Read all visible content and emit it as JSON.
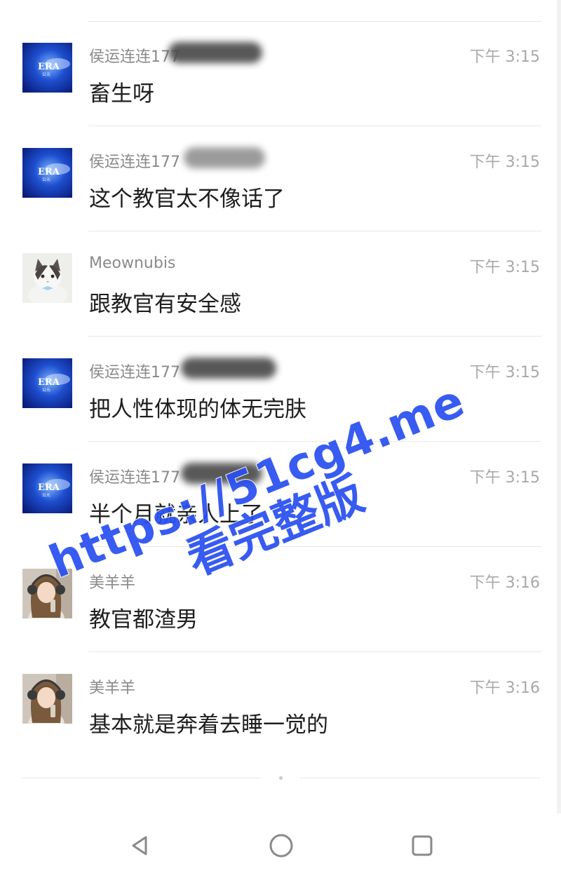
{
  "comments": [
    {
      "avatar": "era-logo",
      "username": "侯运连连177",
      "time": "下午 3:15",
      "message": "畜生呀"
    },
    {
      "avatar": "era-logo",
      "username": "侯运连连177",
      "time": "下午 3:15",
      "message": "这个教官太不像话了"
    },
    {
      "avatar": "cat-photo",
      "username": "Meownubis",
      "time": "下午 3:15",
      "message": "跟教官有安全感"
    },
    {
      "avatar": "era-logo",
      "username": "侯运连连177",
      "time": "下午 3:15",
      "message": "把人性体现的体无完肤"
    },
    {
      "avatar": "era-logo",
      "username": "侯运连连177",
      "time": "下午 3:15",
      "message": "半个月就亲人上了"
    },
    {
      "avatar": "girl-photo",
      "username": "美羊羊",
      "time": "下午 3:16",
      "message": "教官都渣男"
    },
    {
      "avatar": "girl-photo",
      "username": "美羊羊",
      "time": "下午 3:16",
      "message": "基本就是奔着去睡一觉的"
    }
  ],
  "avatar_logo_text": "ERA",
  "avatar_logo_subtext": "公元",
  "watermark": {
    "line1": "https://51cg4.me",
    "line2": "看完整版"
  },
  "nav": {
    "back_icon": "triangle-back-icon",
    "home_icon": "circle-home-icon",
    "recents_icon": "square-recents-icon"
  }
}
